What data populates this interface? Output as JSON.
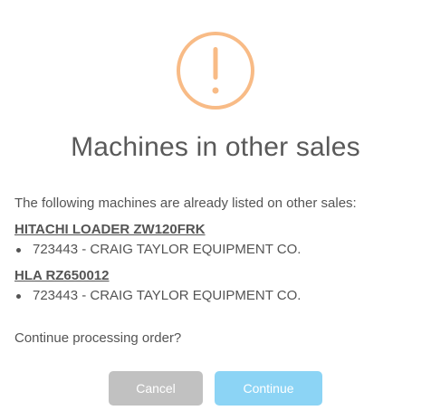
{
  "dialog": {
    "icon": "warning-icon",
    "icon_color": "#f8bb86",
    "title": "Machines in other sales",
    "intro": "The following machines are already listed on other sales:",
    "machines": [
      {
        "name": "HITACHI LOADER ZW120FRK",
        "sales": [
          "723443 - CRAIG TAYLOR EQUIPMENT CO."
        ]
      },
      {
        "name": "HLA RZ650012",
        "sales": [
          "723443 - CRAIG TAYLOR EQUIPMENT CO."
        ]
      }
    ],
    "question": "Continue processing order?",
    "cancel_label": "Cancel",
    "continue_label": "Continue",
    "cancel_color": "#c1c1c1",
    "continue_color": "#8cd4f5"
  }
}
